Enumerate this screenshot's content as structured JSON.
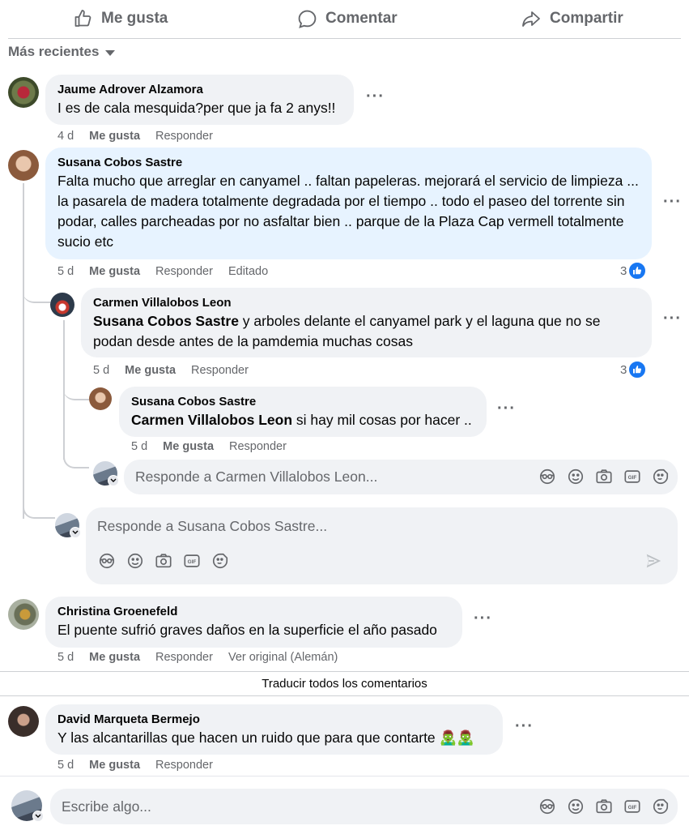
{
  "actions": {
    "like": "Me gusta",
    "comment": "Comentar",
    "share": "Compartir"
  },
  "sort": {
    "label": "Más recientes"
  },
  "comments": [
    {
      "author": "Jaume Adrover Alzamora",
      "text": "I es de cala mesquida?per que ja fa 2 anys!!",
      "age": "4 d",
      "like": "Me gusta",
      "reply": "Responder"
    },
    {
      "author": "Susana Cobos Sastre",
      "text": "Falta mucho que arreglar en canyamel .. faltan papeleras. mejorará el servicio de limpieza ... la pasarela de madera totalmente degradada por el tiempo .. todo el paseo del torrente sin podar, calles parcheadas por no asfaltar bien .. parque de la Plaza Cap vermell totalmente sucio etc",
      "age": "5 d",
      "like": "Me gusta",
      "reply": "Responder",
      "edited": "Editado",
      "reactions": "3"
    },
    {
      "author": "Carmen Villalobos Leon",
      "mention": "Susana Cobos Sastre",
      "text": " y arboles delante el canyamel park y el laguna que no se podan desde antes de la pamdemia muchas cosas",
      "age": "5 d",
      "like": "Me gusta",
      "reply": "Responder",
      "reactions": "3"
    },
    {
      "author": "Susana Cobos Sastre",
      "mention": "Carmen Villalobos Leon",
      "text": " si hay mil cosas por hacer ..",
      "age": "5 d",
      "like": "Me gusta",
      "reply": "Responder"
    },
    {
      "author": "Christina Groenefeld",
      "text": "El puente sufrió graves daños en la superficie el año pasado",
      "age": "5 d",
      "like": "Me gusta",
      "reply": "Responder",
      "original": "Ver original (Alemán)"
    },
    {
      "author": "David Marqueta Bermejo",
      "text": "Y las alcantarillas que hacen un ruido que para que contarte 🧟‍♂️🧟‍♂️",
      "age": "5 d",
      "like": "Me gusta",
      "reply": "Responder"
    }
  ],
  "reply_boxes": {
    "carmen": "Responde a Carmen Villalobos Leon...",
    "susana": "Responde a Susana Cobos Sastre..."
  },
  "translate_all": "Traducir todos los comentarios",
  "composer": {
    "placeholder": "Escribe algo..."
  },
  "colors": {
    "accent": "#1877f2",
    "bubble": "#f0f2f5",
    "highlight": "#e7f3ff",
    "secondary_text": "#65676b"
  }
}
